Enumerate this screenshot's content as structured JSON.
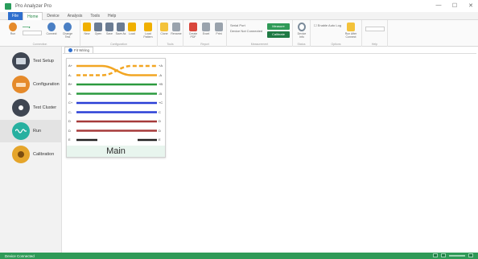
{
  "window": {
    "title": "Pro Analyzer Pro",
    "controls": [
      "—",
      "☐",
      "✕"
    ]
  },
  "menu_tabs": [
    {
      "label": "File"
    },
    {
      "label": "Home"
    },
    {
      "label": "Device"
    },
    {
      "label": "Analysis"
    },
    {
      "label": "Tools"
    },
    {
      "label": "Help"
    }
  ],
  "ribbon": {
    "groups": [
      {
        "label": "Connection",
        "buttons": [
          "Run",
          "Connect",
          "Change Test"
        ]
      },
      {
        "label": "Configuration",
        "buttons": [
          "New",
          "Open",
          "Save",
          "Save As",
          "Load",
          "Load Pattern"
        ]
      },
      {
        "label": "Tools",
        "buttons": [
          "Clone",
          "Rename"
        ]
      },
      {
        "label": "Report",
        "buttons": [
          "Create PDF",
          "Excel",
          "Print"
        ]
      },
      {
        "label": "Measurement",
        "buttons": []
      },
      {
        "label": "Status",
        "buttons": [
          "Device Info"
        ]
      },
      {
        "label": "Options",
        "buttons": []
      },
      {
        "label": "Help",
        "buttons": []
      }
    ],
    "conn_text_1": "Serial Port",
    "conn_text_2": "Device Not Connected",
    "measure_button_1": "Measure",
    "measure_button_2": "Calibrate",
    "options_text": "Enable Auto Log",
    "options_button": "Run After Connect"
  },
  "sidebar": {
    "items": [
      {
        "label": "Test Setup",
        "color": "#3f4652"
      },
      {
        "label": "Configuration",
        "color": "#e58a2b"
      },
      {
        "label": "Test Cluster",
        "color": "#3f4652"
      },
      {
        "label": "Run",
        "color": "#27b0a0"
      },
      {
        "label": "Calibration",
        "color": "#e5a52b"
      }
    ]
  },
  "document_tab": {
    "label": "Fit Wiring"
  },
  "wiring_card": {
    "title": "Main",
    "left_labels": [
      "A+",
      "A-",
      "B+",
      "B-",
      "C+",
      "C-",
      "D",
      "D",
      "E"
    ],
    "right_labels": [
      "+A",
      "-A",
      "+B",
      "-B",
      "+C",
      "C",
      "D",
      "D",
      "E"
    ],
    "wire_colors": [
      "#f2a623",
      "#f2a623",
      "#2b9a3f",
      "#2b9a3f",
      "#2a3fd6",
      "#2a3fd6",
      "#a63a3a",
      "#a63a3a",
      "#222222"
    ]
  },
  "status": {
    "text": "Device Connected"
  },
  "colors": {
    "accent": "#2f9a57",
    "brand_blue": "#2f6fce"
  }
}
